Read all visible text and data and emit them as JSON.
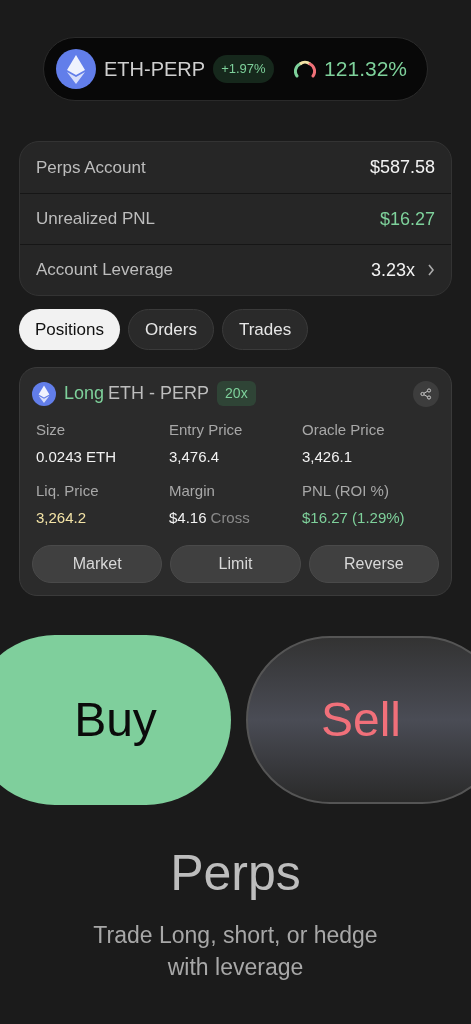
{
  "ticker": {
    "symbol": "ETH-PERP",
    "change": "+1.97%",
    "ratio": "121.32%"
  },
  "account": [
    {
      "label": "Perps Account",
      "value": "$587.58",
      "color": "#f2f2f2",
      "chevron": false
    },
    {
      "label": "Unrealized PNL",
      "value": "$16.27",
      "color": "#7ed19b",
      "chevron": false
    },
    {
      "label": "Account Leverage",
      "value": "3.23x",
      "color": "#f2f2f2",
      "chevron": true
    }
  ],
  "tabs": [
    {
      "label": "Positions",
      "selected": true
    },
    {
      "label": "Orders",
      "selected": false
    },
    {
      "label": "Trades",
      "selected": false
    }
  ],
  "position": {
    "side": "Long",
    "market": "ETH - PERP",
    "leverage": "20x",
    "fields": [
      {
        "label": "Size",
        "value": "0.0243 ETH",
        "color": "#f2f2f2"
      },
      {
        "label": "Entry Price",
        "value": "3,476.4",
        "color": "#f2f2f2"
      },
      {
        "label": "Oracle Price",
        "value": "3,426.1",
        "color": "#f2f2f2"
      },
      {
        "label": "Liq. Price",
        "value": "3,264.2",
        "color": "#f3e3a6"
      },
      {
        "label": "Margin",
        "value": "$4.16",
        "suffix": "Cross",
        "color": "#f2f2f2"
      },
      {
        "label": "PNL (ROI %)",
        "value": "$16.27 (1.29%)",
        "color": "#7ed19b"
      }
    ],
    "actions": [
      "Market",
      "Limit",
      "Reverse"
    ]
  },
  "buy": "Buy",
  "sell": "Sell",
  "title": "Perps",
  "subtitle": "Trade Long, short, or hedge with leverage"
}
